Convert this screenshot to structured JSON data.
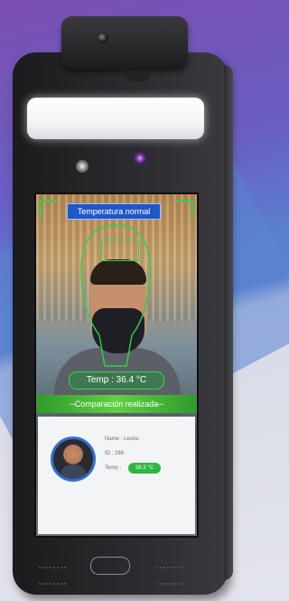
{
  "screen": {
    "status_title": "Temperatura normal",
    "forehead_label": "",
    "temp_reading": "Temp : 36.4 °C",
    "compare_banner": "--Comparación realizada--",
    "card": {
      "name_label": "Name",
      "name_value": "Leone",
      "id_label": "ID",
      "id_value": "288",
      "temp_label": "Temp",
      "temp_value": "36.3 °C"
    }
  },
  "colors": {
    "frame_green": "#2fd14a",
    "title_blue": "#1f57c8",
    "badge_green": "#2fb63e"
  },
  "icons": [
    "camera-lens-icon",
    "ir-sensor-icon",
    "rgb-sensor-icon",
    "speaker-grille-icon",
    "brand-logo-icon"
  ]
}
